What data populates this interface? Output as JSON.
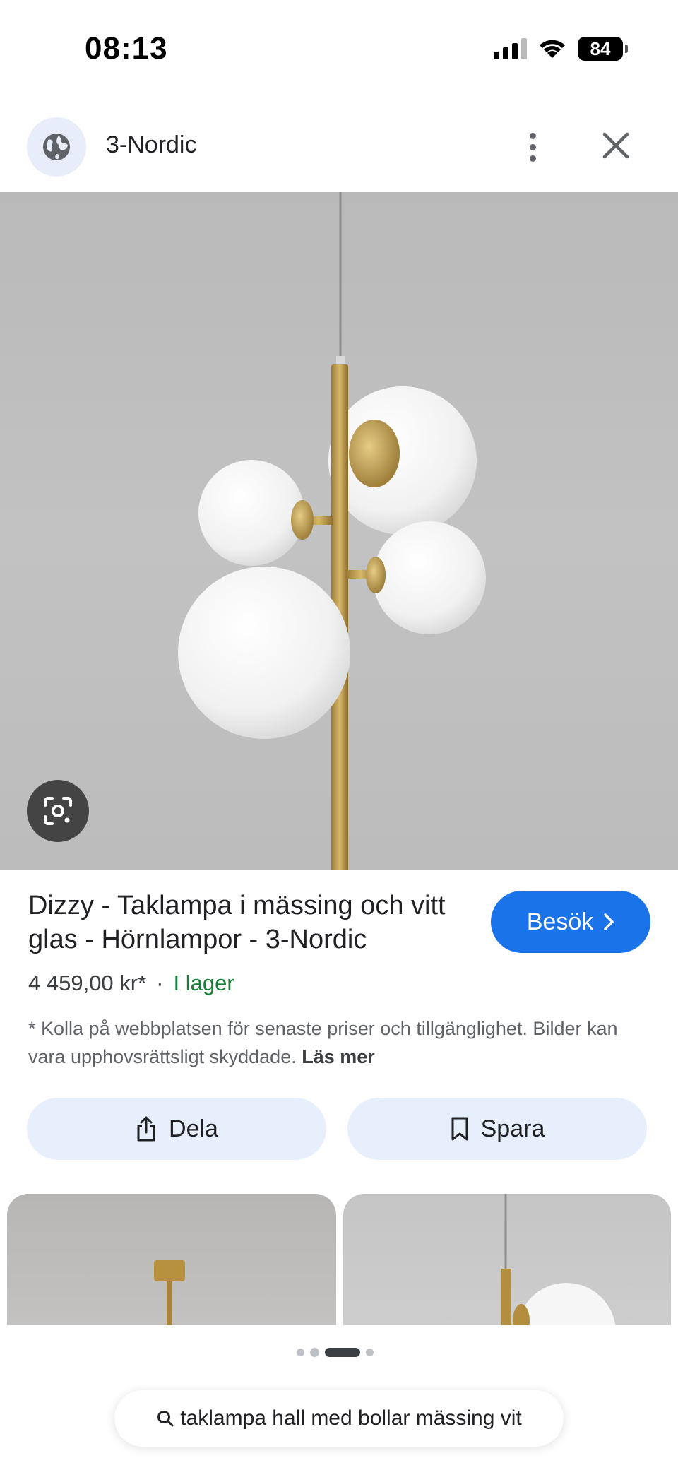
{
  "status_bar": {
    "time": "08:13",
    "battery": "84"
  },
  "header": {
    "site_name": "3-Nordic",
    "site_icon": "globe-icon",
    "more_icon": "more-vertical-icon",
    "close_icon": "close-icon"
  },
  "product": {
    "title": "Dizzy - Taklampa i mässing och vitt glas - Hörnlampor - 3-Nordic",
    "visit_label": "Besök",
    "price": "4 459,00 kr*",
    "separator": "·",
    "stock": "I lager",
    "disclaimer": "* Kolla på webbplatsen för senaste priser och tillgänglighet. Bilder kan vara upphovsrättsligt skyddade.",
    "read_more": "Läs mer"
  },
  "actions": {
    "share_label": "Dela",
    "save_label": "Spara"
  },
  "carousel": {
    "page_count": 4,
    "active_index": 2
  },
  "search": {
    "query": "taklampa hall med bollar mässing vit"
  },
  "colors": {
    "accent": "#1a73e8",
    "stock_green": "#188038",
    "pill_bg": "#e8effc"
  }
}
